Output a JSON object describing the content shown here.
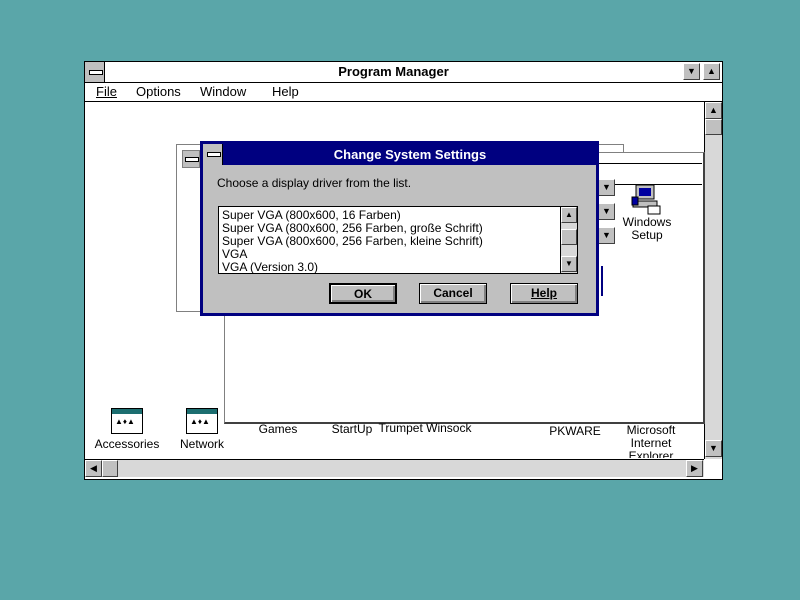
{
  "program_manager": {
    "title": "Program Manager",
    "menu": [
      {
        "label": "File",
        "mnemonic_index": 0
      },
      {
        "label": "Options",
        "mnemonic_index": 0
      },
      {
        "label": "Window",
        "mnemonic_index": 0
      },
      {
        "label": "Help",
        "mnemonic_index": 0
      }
    ],
    "group_icons": [
      {
        "label": "Accessories"
      },
      {
        "label": "Network"
      },
      {
        "label": "Games"
      },
      {
        "label": "StartUp"
      },
      {
        "label": "Trumpet Winsock"
      },
      {
        "label": "PKWARE"
      },
      {
        "label": "Microsoft Internet Explorer"
      }
    ],
    "program_icons": [
      {
        "label": "Windows Setup",
        "icon": "computer-icon"
      }
    ]
  },
  "dialog": {
    "title": "Change System Settings",
    "prompt": "Choose a display driver from the list.",
    "drivers": [
      "Super VGA (800x600, 16 Farben)",
      "Super VGA (800x600, 256 Farben, große Schrift)",
      "Super VGA (800x600, 256 Farben, kleine Schrift)",
      "VGA",
      "VGA (Version 3.0)"
    ],
    "buttons": {
      "ok": "OK",
      "cancel": "Cancel",
      "help": "Help"
    }
  },
  "colors": {
    "desktop": "#5aa6a9",
    "active_title": "#000080",
    "window_face": "#c0c0c0"
  }
}
